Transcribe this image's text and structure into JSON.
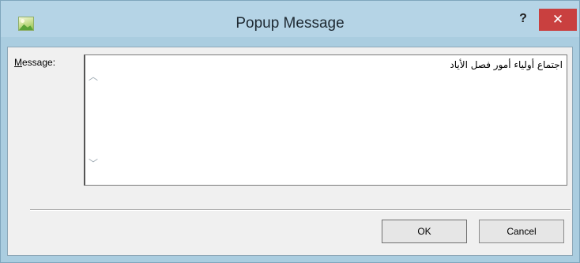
{
  "window": {
    "title": "Popup Message",
    "help_glyph": "?",
    "close_glyph": "✕",
    "icon": "app-picture-icon"
  },
  "form": {
    "message_label_accel": "M",
    "message_label_rest": "essage:",
    "message_value": "اجتماع أولياء أمور فصل الأياد",
    "scroll_up_glyph": "︿",
    "scroll_down_glyph": "﹀"
  },
  "buttons": {
    "ok_label": "OK",
    "cancel_label": "Cancel"
  },
  "colors": {
    "titlebar": "#b5d4e6",
    "close_button": "#c9403f",
    "client_background": "#f0f0f0"
  }
}
